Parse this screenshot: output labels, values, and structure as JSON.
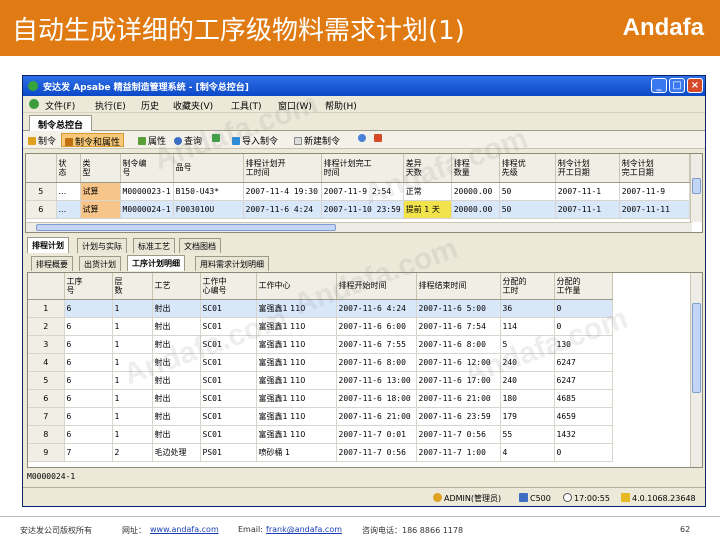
{
  "slide": {
    "title": "自动生成详细的工序级物料需求计划(1)",
    "brand": "Andafa",
    "page_number": "62",
    "footer": {
      "company": "安达发公司版权所有",
      "website_label": "网址：",
      "website": "www.andafa.com",
      "email_label": "Email:",
      "email": "frank@andafa.com",
      "phone": "咨询电话：186 8866 1178"
    },
    "watermark": "Andafa.com"
  },
  "window": {
    "title": "安达发 Apsabe 精益制造管理系统 - [制令总控台]",
    "buttons": {
      "minimize": "_",
      "maximize": "□",
      "close": "×"
    }
  },
  "menu": [
    "文件(F)",
    "执行(E)",
    "历史",
    "收藏夹(V)",
    "工具(T)",
    "窗口(W)",
    "帮助(H)"
  ],
  "doc_tab": "制令总控台",
  "toolbar": [
    "制令",
    "制令和属性",
    "属性",
    "查询",
    "导入制令",
    "新建制令"
  ],
  "top_grid": {
    "columns": [
      "",
      "状\n态",
      "类\n型",
      "制令编\n号",
      "品号",
      "排程计划开\n工时间",
      "排程计划完工\n时间",
      "差异\n天数",
      "排程\n数量",
      "排程优\n先级",
      "制令计划\n开工日期",
      "制令计划\n完工日期"
    ],
    "rows": [
      [
        "5",
        "...",
        "试算",
        "M0000023-1",
        "B150-U43*",
        "2007-11-4 19:30",
        "2007-11-9 2:54",
        "正常",
        "20000.00",
        "50",
        "2007-11-1",
        "2007-11-9"
      ],
      [
        "6",
        "...",
        "试算",
        "M0000024-1",
        "F003010U",
        "2007-11-6 4:24",
        "2007-11-10 23:59",
        "提前 1 天",
        "20000.00",
        "50",
        "2007-11-1",
        "2007-11-11"
      ]
    ]
  },
  "tabs_level1": [
    "排程计划",
    "计划与实际",
    "标准工艺",
    "文档图档"
  ],
  "tabs_level2": [
    "排程概要",
    "出货计划",
    "工序计划明细",
    "用料需求计划明细"
  ],
  "bottom_grid": {
    "columns": [
      "",
      "工序\n号",
      "层\n数",
      "工艺",
      "工作中\n心编号",
      "工作中心",
      "排程开始时间",
      "排程结束时间",
      "分配的\n工时",
      "分配的\n工作量"
    ],
    "rows": [
      [
        "1",
        "6",
        "1",
        "射出",
        "SC01",
        "富强鑫1 110",
        "2007-11-6 4:24",
        "2007-11-6 5:00",
        "36",
        "0"
      ],
      [
        "2",
        "6",
        "1",
        "射出",
        "SC01",
        "富强鑫1 110",
        "2007-11-6 6:00",
        "2007-11-6 7:54",
        "114",
        "0"
      ],
      [
        "3",
        "6",
        "1",
        "射出",
        "SC01",
        "富强鑫1 110",
        "2007-11-6 7:55",
        "2007-11-6 8:00",
        "5",
        "130"
      ],
      [
        "4",
        "6",
        "1",
        "射出",
        "SC01",
        "富强鑫1 110",
        "2007-11-6 8:00",
        "2007-11-6 12:00",
        "240",
        "6247"
      ],
      [
        "5",
        "6",
        "1",
        "射出",
        "SC01",
        "富强鑫1 110",
        "2007-11-6 13:00",
        "2007-11-6 17:00",
        "240",
        "6247"
      ],
      [
        "6",
        "6",
        "1",
        "射出",
        "SC01",
        "富强鑫1 110",
        "2007-11-6 18:00",
        "2007-11-6 21:00",
        "180",
        "4685"
      ],
      [
        "7",
        "6",
        "1",
        "射出",
        "SC01",
        "富强鑫1 110",
        "2007-11-6 21:00",
        "2007-11-6 23:59",
        "179",
        "4659"
      ],
      [
        "8",
        "6",
        "1",
        "射出",
        "SC01",
        "富强鑫1 110",
        "2007-11-7 0:01",
        "2007-11-7 0:56",
        "55",
        "1432"
      ],
      [
        "9",
        "7",
        "2",
        "毛边处理",
        "PS01",
        "喷砂桶 1",
        "2007-11-7 0:56",
        "2007-11-7 1:00",
        "4",
        "0"
      ]
    ]
  },
  "status_left": "M0000024-1",
  "status": {
    "user": "ADMIN(管理员)",
    "code": "C500",
    "time": "17:00:55",
    "version": "4.0.1068.23648"
  },
  "colors": {
    "accent": "#e07a12",
    "titlebar": "#0b48c8",
    "selected_row": "#d9e7fb",
    "highlight": "#f7c48a",
    "warning": "#f2e24c"
  }
}
